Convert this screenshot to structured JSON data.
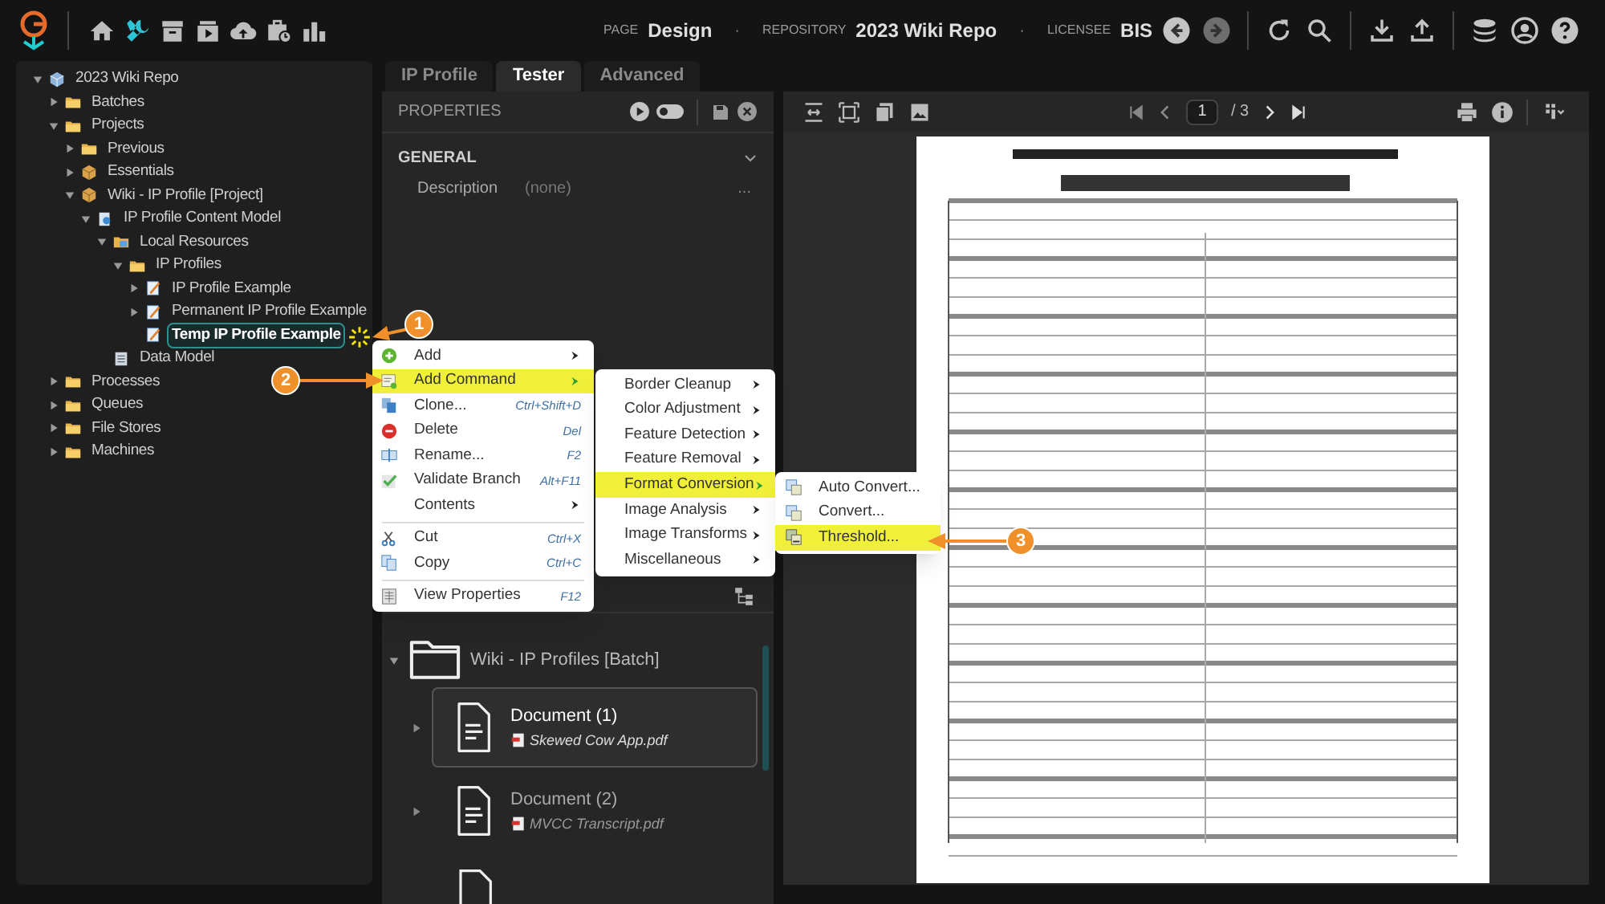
{
  "header": {
    "app_tools": [
      {
        "kind": "home",
        "selected": false
      },
      {
        "kind": "tools",
        "selected": true
      },
      {
        "kind": "archive",
        "selected": false
      },
      {
        "kind": "media",
        "selected": false
      },
      {
        "kind": "upload",
        "selected": false
      },
      {
        "kind": "schedule",
        "selected": false
      },
      {
        "kind": "chart",
        "selected": false
      }
    ],
    "page_label": "PAGE",
    "page": "Design",
    "separators": [
      "·",
      "·"
    ],
    "repository_label": "REPOSITORY",
    "repository": "2023 Wiki Repo",
    "licensee_label": "LICENSEE",
    "licensee": "BIS",
    "nav": [
      {
        "kind": "back",
        "disabled": false
      },
      {
        "kind": "forward",
        "disabled": true
      }
    ]
  },
  "tree": [
    {
      "label": "2023 Wiki Repo",
      "kind": "repo",
      "expanded": true,
      "selected": false,
      "children": [
        {
          "label": "Batches",
          "kind": "folder",
          "expanded": false,
          "selected": false
        },
        {
          "label": "Projects",
          "kind": "folder",
          "expanded": true,
          "selected": false,
          "children": [
            {
              "label": "Previous",
              "kind": "folder",
              "expanded": false,
              "selected": false
            },
            {
              "label": "Essentials",
              "kind": "package",
              "expanded": false,
              "selected": false
            },
            {
              "label": "Wiki - IP Profile [Project]",
              "kind": "package",
              "expanded": true,
              "selected": false,
              "children": [
                {
                  "label": "IP Profile Content Model",
                  "kind": "model",
                  "expanded": true,
                  "selected": false,
                  "children": [
                    {
                      "label": "Local Resources",
                      "kind": "resources",
                      "expanded": true,
                      "selected": false,
                      "children": [
                        {
                          "label": "IP Profiles",
                          "kind": "folder",
                          "expanded": true,
                          "selected": false,
                          "children": [
                            {
                              "label": "IP Profile Example",
                              "kind": "profile",
                              "expanded": false,
                              "selected": false
                            },
                            {
                              "label": "Permanent IP Profile Example",
                              "kind": "profile",
                              "expanded": false,
                              "selected": false
                            },
                            {
                              "label": "Temp IP Profile Example",
                              "kind": "profile",
                              "selected": true
                            }
                          ]
                        }
                      ]
                    },
                    {
                      "label": "Data Model",
                      "kind": "data",
                      "selected": false
                    }
                  ]
                }
              ]
            }
          ]
        },
        {
          "label": "Processes",
          "kind": "folder",
          "expanded": false,
          "selected": false
        },
        {
          "label": "Queues",
          "kind": "folder",
          "expanded": false,
          "selected": false
        },
        {
          "label": "File Stores",
          "kind": "folder",
          "expanded": false,
          "selected": false
        },
        {
          "label": "Machines",
          "kind": "folder",
          "expanded": false,
          "selected": false
        }
      ]
    }
  ],
  "tabs": [
    {
      "label": "IP Profile",
      "selected": false
    },
    {
      "label": "Tester",
      "selected": true
    },
    {
      "label": "Advanced",
      "selected": false
    }
  ],
  "properties": {
    "title": "PROPERTIES",
    "toggle_on": false,
    "section": "GENERAL",
    "section_expanded": true,
    "fields": [
      {
        "label": "Description",
        "value": "(none)",
        "more": "..."
      }
    ]
  },
  "batch": {
    "label": "Wiki - IP Profiles [Batch]",
    "expanded": true,
    "documents": [
      {
        "title": "Document (1)",
        "file": "Skewed Cow App.pdf",
        "selected": true
      },
      {
        "title": "Document (2)",
        "file": "MVCC Transcript.pdf",
        "selected": false
      }
    ]
  },
  "viewer": {
    "page": "1",
    "total": "/ 3"
  },
  "context_menu": [
    {
      "kind": "submenu",
      "label": "Add",
      "highlighted": false
    },
    {
      "kind": "submenu",
      "label": "Add Command",
      "highlighted": true
    },
    {
      "kind": "item",
      "label": "Clone...",
      "shortcut": "Ctrl+Shift+D",
      "highlighted": false
    },
    {
      "kind": "item",
      "label": "Delete",
      "shortcut": "Del",
      "highlighted": false
    },
    {
      "kind": "item",
      "label": "Rename...",
      "shortcut": "F2",
      "highlighted": false
    },
    {
      "kind": "item",
      "label": "Validate Branch",
      "shortcut": "Alt+F11",
      "highlighted": false
    },
    {
      "kind": "submenu",
      "label": "Contents",
      "highlighted": false
    },
    {
      "kind": "separator"
    },
    {
      "kind": "item",
      "label": "Cut",
      "shortcut": "Ctrl+X",
      "highlighted": false
    },
    {
      "kind": "item",
      "label": "Copy",
      "shortcut": "Ctrl+C",
      "highlighted": false
    },
    {
      "kind": "separator"
    },
    {
      "kind": "item",
      "label": "View Properties",
      "shortcut": "F12",
      "highlighted": false
    }
  ],
  "command_menu": [
    {
      "label": "Border Cleanup",
      "highlighted": false
    },
    {
      "label": "Color Adjustment",
      "highlighted": false
    },
    {
      "label": "Feature Detection",
      "highlighted": false
    },
    {
      "label": "Feature Removal",
      "highlighted": false
    },
    {
      "label": "Format Conversion",
      "highlighted": true
    },
    {
      "label": "Image Analysis",
      "highlighted": false
    },
    {
      "label": "Image Transforms",
      "highlighted": false
    },
    {
      "label": "Miscellaneous",
      "highlighted": false
    }
  ],
  "conversion_menu": [
    {
      "label": "Auto Convert...",
      "highlighted": false
    },
    {
      "label": "Convert...",
      "highlighted": false
    },
    {
      "label": "Threshold...",
      "highlighted": true
    }
  ],
  "callouts": [
    "1",
    "2",
    "3"
  ]
}
